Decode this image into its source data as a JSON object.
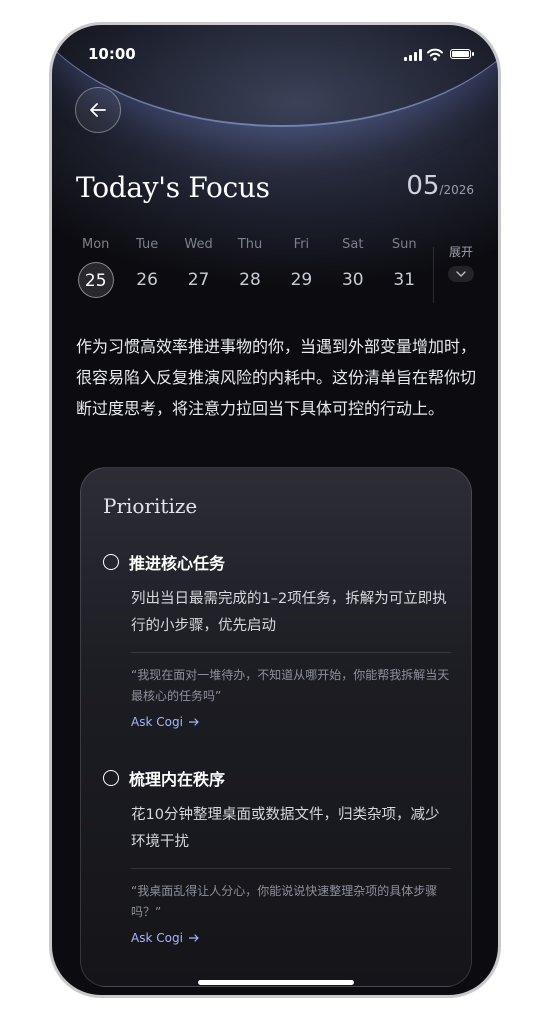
{
  "status": {
    "time": "10:00"
  },
  "header": {
    "title": "Today's Focus",
    "month": "05",
    "year": "/2026"
  },
  "week": [
    {
      "name": "Mon",
      "date": "25",
      "active": true
    },
    {
      "name": "Tue",
      "date": "26"
    },
    {
      "name": "Wed",
      "date": "27"
    },
    {
      "name": "Thu",
      "date": "28"
    },
    {
      "name": "Fri",
      "date": "29"
    },
    {
      "name": "Sat",
      "date": "30"
    },
    {
      "name": "Sun",
      "date": "31"
    }
  ],
  "expand_label": "展开",
  "intro": "作为习惯高效率推进事物的你，当遇到外部变量增加时，很容易陷入反复推演风险的内耗中。这份清单旨在帮你切断过度思考，将注意力拉回当下具体可控的行动上。",
  "card": {
    "title": "Prioritize",
    "tasks": [
      {
        "title": "推进核心任务",
        "desc": "列出当日最需完成的1–2项任务，拆解为可立即执行的小步骤，优先启动",
        "quote": "“我现在面对一堆待办，不知道从哪开始，你能帮我拆解当天最核心的任务吗”",
        "ask": "Ask Cogi"
      },
      {
        "title": "梳理内在秩序",
        "desc": "花10分钟整理桌面或数据文件，归类杂项，减少环境干扰",
        "quote": "“我桌面乱得让人分心，你能说说快速整理杂项的具体步骤吗？”",
        "ask": "Ask Cogi"
      }
    ]
  },
  "colors": {
    "accent": "#a8b4ff",
    "background": "#0c0c10",
    "card": "#1c1d23"
  }
}
